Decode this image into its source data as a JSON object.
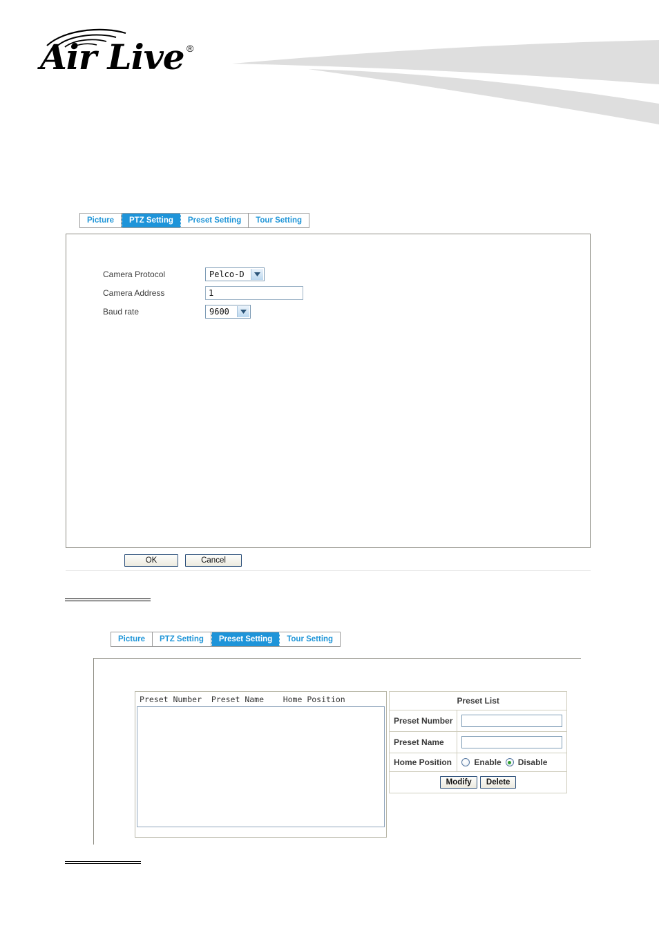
{
  "brand": {
    "logo_text": "Air Live",
    "registered_mark": "®",
    "logo_icon": "wifi-arcs-icon"
  },
  "ptz_section": {
    "tabs": [
      {
        "label": "Picture",
        "active": false
      },
      {
        "label": "PTZ Setting",
        "active": true
      },
      {
        "label": "Preset Setting",
        "active": false
      },
      {
        "label": "Tour Setting",
        "active": false
      }
    ],
    "fields": {
      "camera_protocol": {
        "label": "Camera Protocol",
        "value": "Pelco-D"
      },
      "camera_address": {
        "label": "Camera Address",
        "value": "1"
      },
      "baud_rate": {
        "label": "Baud rate",
        "value": "9600"
      }
    },
    "buttons": {
      "ok": "OK",
      "cancel": "Cancel"
    }
  },
  "preset_section": {
    "tabs": [
      {
        "label": "Picture",
        "active": false
      },
      {
        "label": "PTZ Setting",
        "active": false
      },
      {
        "label": "Preset Setting",
        "active": true
      },
      {
        "label": "Tour Setting",
        "active": false
      }
    ],
    "list": {
      "columns_line": "Preset Number  Preset Name    Home Position",
      "rows": []
    },
    "panel": {
      "title": "Preset List",
      "preset_number_label": "Preset Number",
      "preset_number_value": "",
      "preset_name_label": "Preset Name",
      "preset_name_value": "",
      "home_position_label": "Home Position",
      "enable_label": "Enable",
      "disable_label": "Disable",
      "home_position_selected": "Disable",
      "modify_button": "Modify",
      "delete_button": "Delete"
    }
  }
}
